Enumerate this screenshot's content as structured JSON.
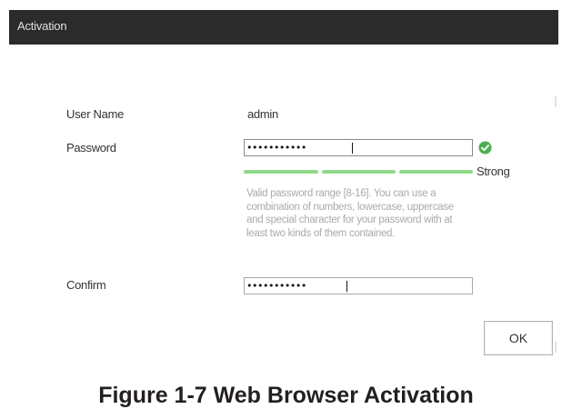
{
  "window": {
    "title": "Activation"
  },
  "form": {
    "username_label": "User Name",
    "username_value": "admin",
    "password_label": "Password",
    "password_value": "•••••••••••",
    "strength": {
      "label": "Strong",
      "level": 1.0,
      "color": "#8fd98b",
      "status_icon": "check-circle-icon",
      "status_color": "#4caf50"
    },
    "hint": "Valid password range [8-16]. You can use a combination of numbers, lowercase, uppercase and special character for your password with at least two kinds of them contained.",
    "confirm_label": "Confirm",
    "confirm_value": "•••••••••••"
  },
  "actions": {
    "ok_label": "OK"
  },
  "caption": "Figure 1-7 Web Browser Activation"
}
